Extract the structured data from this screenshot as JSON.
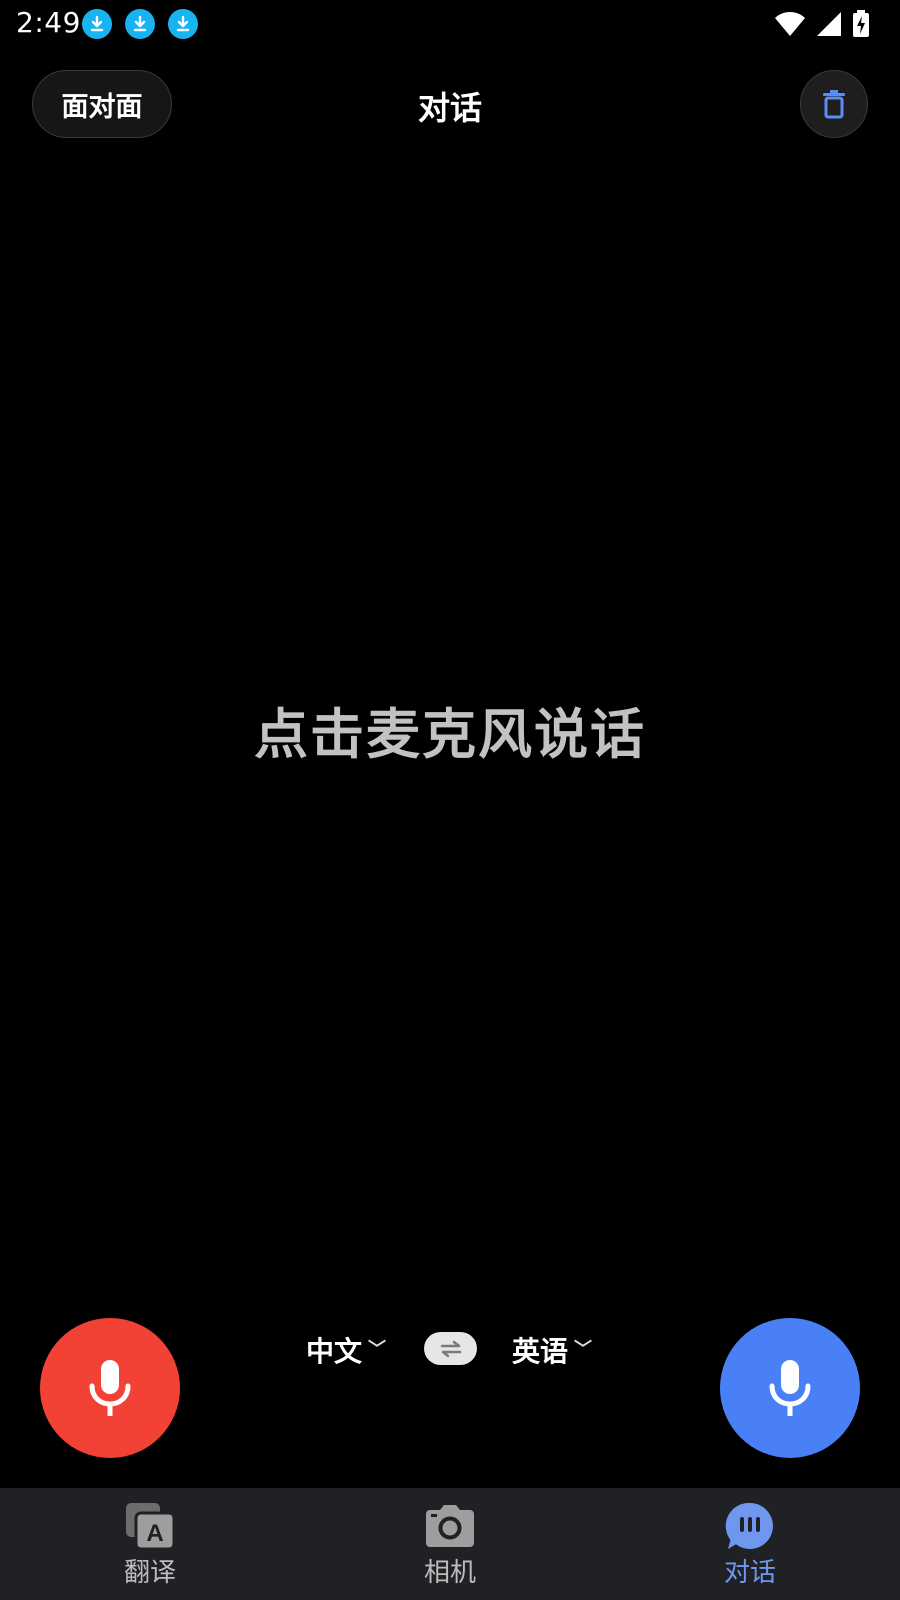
{
  "status_bar": {
    "time": "2:49",
    "left_icons": [
      "download-icon",
      "download-icon",
      "download-icon"
    ],
    "right_icons": [
      "wifi-icon",
      "signal-icon",
      "battery-charging-icon"
    ]
  },
  "header": {
    "face_to_face_label": "面对面",
    "title": "对话",
    "trash_icon": "trash-icon"
  },
  "main": {
    "prompt": "点击麦克风说话"
  },
  "language_bar": {
    "source_language": "中文",
    "target_language": "英语",
    "chevron": "﹀"
  },
  "mic_buttons": {
    "left_color": "#f24236",
    "right_color": "#4a80f5"
  },
  "bottom_nav": {
    "items": [
      {
        "label": "翻译",
        "icon": "translate-icon",
        "active": false
      },
      {
        "label": "相机",
        "icon": "camera-icon",
        "active": false
      },
      {
        "label": "对话",
        "icon": "conversation-icon",
        "active": true
      }
    ],
    "active_color": "#6f97f0"
  }
}
